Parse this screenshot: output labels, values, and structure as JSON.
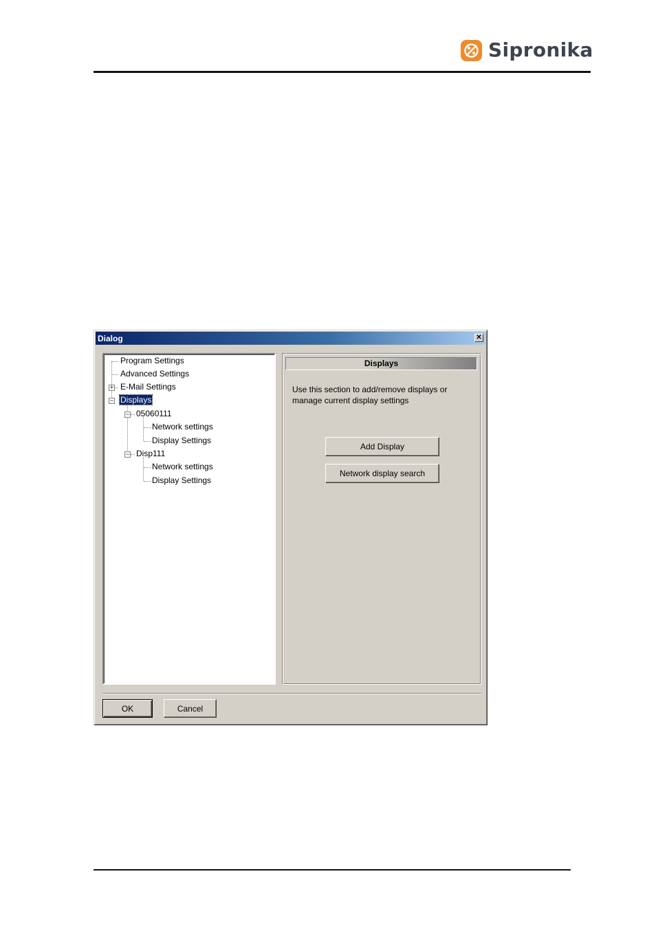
{
  "header": {
    "brand": "Sipronika",
    "accent_color": "#f08a2c",
    "text_color": "#3d4450",
    "logo_icon": "sipronika-logo-icon"
  },
  "dialog": {
    "title": "Dialog",
    "close_symbol": "✕",
    "tree": {
      "items": [
        {
          "label": "Program Settings"
        },
        {
          "label": "Advanced Settings"
        },
        {
          "label": "E-Mail Settings",
          "expander": "+"
        },
        {
          "label": "Displays",
          "expander": "−",
          "selected": true
        },
        {
          "label": "05060111",
          "expander": "−"
        },
        {
          "label": "Network settings"
        },
        {
          "label": "Display Settings"
        },
        {
          "label": "Disp111",
          "expander": "−"
        },
        {
          "label": "Network settings"
        },
        {
          "label": "Display Settings"
        }
      ]
    },
    "panel": {
      "header": "Displays",
      "description": "Use this section to add/remove displays or manage current display settings",
      "add_display_label": "Add Display",
      "network_search_label": "Network display search"
    },
    "footer": {
      "ok_label": "OK",
      "cancel_label": "Cancel"
    }
  }
}
